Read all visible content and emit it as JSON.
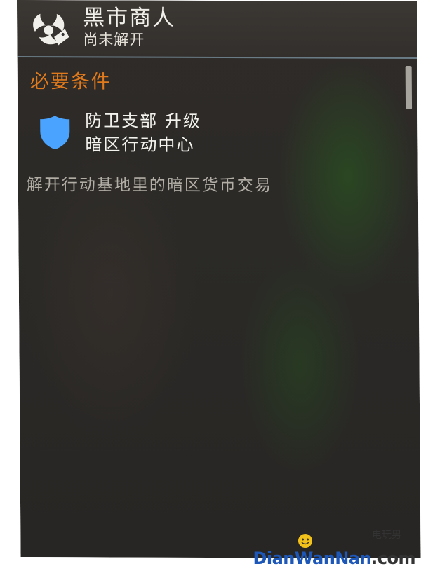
{
  "header": {
    "icon": "biohazard-icon",
    "title": "黑市商人",
    "subtitle": "尚未解开"
  },
  "requirements": {
    "section_title": "必要条件",
    "items": [
      {
        "icon": "shield-icon",
        "line1": "防卫支部 升级",
        "line2": "暗区行动中心"
      }
    ]
  },
  "description": "解开行动基地里的暗区货币交易",
  "watermark": {
    "chinese": "电玩男",
    "url_main": "DianWanNan",
    "url_suffix": ".com"
  },
  "colors": {
    "accent_orange": "#e07a1c",
    "shield_blue": "#4aa3ff",
    "panel_bg": "#2b2a27"
  }
}
